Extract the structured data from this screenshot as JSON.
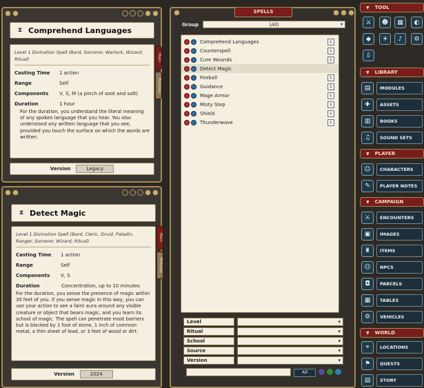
{
  "spell_windows": [
    {
      "name": "Comprehend Languages",
      "meta": "Level 1 Divination Spell (Bard, Sorcerer, Warlock, Wizard; Ritual)",
      "fields": [
        {
          "key": "Casting Time",
          "value": "1 action"
        },
        {
          "key": "Range",
          "value": "Self"
        },
        {
          "key": "Components",
          "value": "V, S, M (a pinch of soot and salt)"
        },
        {
          "key": "Duration",
          "value": "1 hour"
        }
      ],
      "description": "For the duration, you understand the literal meaning of any spoken language that you hear. You also understand any written language that you see, provided you touch the surface on which the words are written.",
      "version_label": "Version",
      "version_value": "Legacy",
      "tab_main": "Main",
      "tab_pictures": "Pictures"
    },
    {
      "name": "Detect Magic",
      "meta": "Level 1 Divination Spell (Bard, Cleric, Druid, Paladin, Ranger, Sorcerer, Wizard; Ritual)",
      "fields": [
        {
          "key": "Casting Time",
          "value": "1 action"
        },
        {
          "key": "Range",
          "value": "Self"
        },
        {
          "key": "Components",
          "value": "V, S"
        },
        {
          "key": "Duration",
          "value": "Concentration, up to 10 minutes"
        }
      ],
      "description": "For the duration, you sense the presence of magic within 30 feet of you. If you sense magic in this way, you can use your action to see a faint aura around any visible creature or object that bears magic, and you learn its school of magic. The spell can penetrate most barriers but is blocked by 1 foot of stone, 1 inch of common metal, a thin sheet of lead, or 3 feet of wood or dirt.",
      "version_label": "Version",
      "version_value": "2024",
      "tab_main": "Main",
      "tab_pictures": "Pictures"
    }
  ],
  "spells_panel": {
    "title": "SPELLS",
    "group_label": "Group",
    "group_value": "(All)",
    "items": [
      "Comprehend Languages",
      "Counterspell",
      "Cure Wounds",
      "Detect Magic",
      "Fireball",
      "Guidance",
      "Mage Armor",
      "Misty Step",
      "Shield",
      "Thunderwave"
    ],
    "link_glyph": "L",
    "filters": [
      "Level",
      "Ritual",
      "School",
      "Source",
      "Version"
    ],
    "search_button": "All"
  },
  "sidebar": {
    "tool_label": "TOOL",
    "library_label": "LIBRARY",
    "library_items": [
      "MODULES",
      "ASSETS",
      "BOOKS",
      "SOUND SETS"
    ],
    "player_label": "PLAYER",
    "player_items": [
      "CHARACTERS",
      "PLAYER NOTES"
    ],
    "campaign_label": "CAMPAIGN",
    "campaign_items": [
      "ENCOUNTERS",
      "IMAGES",
      "ITEMS",
      "NPCS",
      "PARCELS",
      "TABLES",
      "VEHICLES"
    ],
    "world_label": "WORLD",
    "world_items": [
      "LOCATIONS",
      "QUESTS",
      "STORY"
    ]
  },
  "colors": {
    "accent_red": "#7a1c1c",
    "nav_blue": "#1c2f3b",
    "paper": "#f4efe0",
    "gold": "#a48a55"
  }
}
